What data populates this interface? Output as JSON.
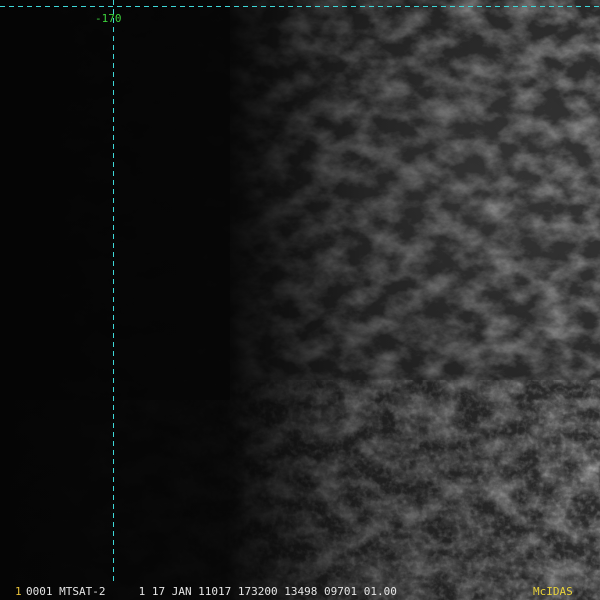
{
  "overlay": {
    "longitude_label": "-170",
    "grid_color": "#3ed8d8",
    "label_color": "#3cd23c"
  },
  "status_bar": {
    "frame_number": "1",
    "text": "0001 MTSAT-2     1 17 JAN 11017 173200 13498 09701 01.00",
    "brand": "McIDAS"
  },
  "colors": {
    "background": "#050505",
    "frame_number": "#e8c23a",
    "brand": "#e8d23a"
  }
}
